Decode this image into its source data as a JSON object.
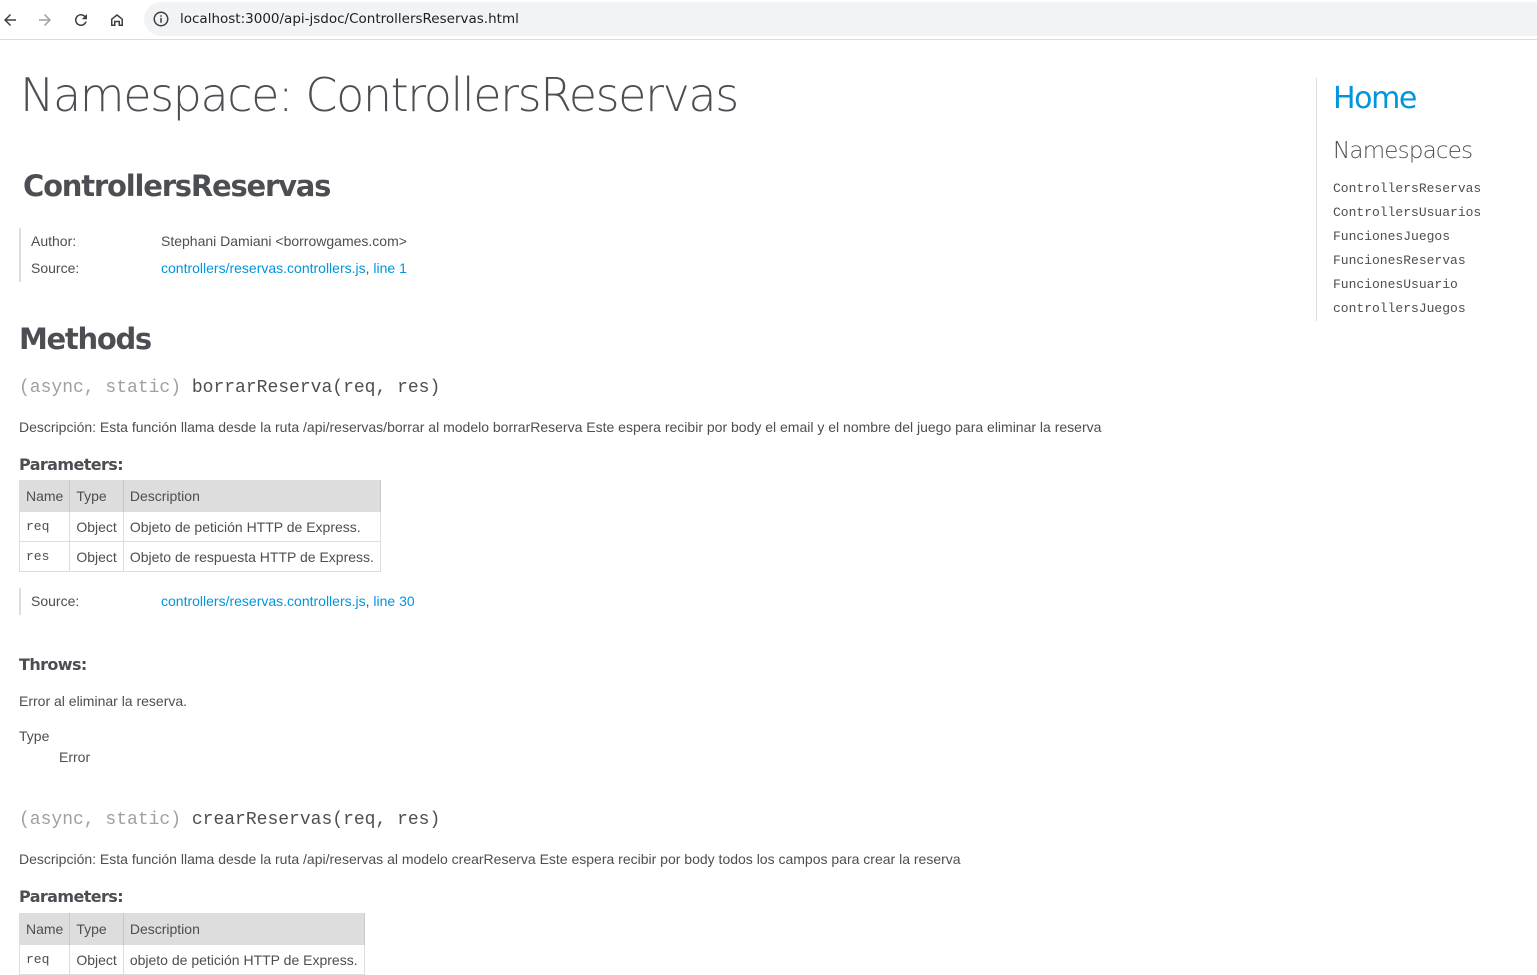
{
  "browser": {
    "url": "localhost:3000/api-jsdoc/ControllersReservas.html",
    "back_icon": "arrow-left-icon",
    "forward_icon": "arrow-right-icon",
    "reload_icon": "reload-icon",
    "home_icon": "home-icon",
    "site_info_icon": "info-circle-icon"
  },
  "page": {
    "title": "Namespace: ControllersReservas",
    "namespace_heading": "ControllersReservas",
    "details": {
      "author_label": "Author:",
      "author_value": "Stephani Damiani <borrowgames.com>",
      "source_label": "Source:",
      "source_file": "controllers/reservas.controllers.js",
      "source_line": "line 1"
    },
    "methods_heading": "Methods"
  },
  "methods": [
    {
      "attrs": "(async, static)",
      "signature": "borrarReserva(req, res)",
      "description": "Descripción: Esta función llama desde la ruta /api/reservas/borrar al modelo borrarReserva Este espera recibir por body el email y el nombre del juego para eliminar la reserva",
      "parameters_heading": "Parameters:",
      "table_headers": [
        "Name",
        "Type",
        "Description"
      ],
      "params": [
        {
          "name": "req",
          "type": "Object",
          "description": "Objeto de petición HTTP de Express."
        },
        {
          "name": "res",
          "type": "Object",
          "description": "Objeto de respuesta HTTP de Express."
        }
      ],
      "source_label": "Source:",
      "source_file": "controllers/reservas.controllers.js",
      "source_line": "line 30",
      "throws_heading": "Throws:",
      "throws_description": "Error al eliminar la reserva.",
      "type_label": "Type",
      "type_value": "Error"
    },
    {
      "attrs": "(async, static)",
      "signature": "crearReservas(req, res)",
      "description": "Descripción: Esta función llama desde la ruta /api/reservas al modelo crearReserva Este espera recibir por body todos los campos para crear la reserva",
      "parameters_heading": "Parameters:",
      "table_headers": [
        "Name",
        "Type",
        "Description"
      ],
      "params": [
        {
          "name": "req",
          "type": "Object",
          "description": "objeto de petición HTTP de Express."
        }
      ]
    }
  ],
  "sidebar": {
    "home": "Home",
    "namespaces_heading": "Namespaces",
    "items": [
      "ControllersReservas",
      "ControllersUsuarios",
      "FuncionesJuegos",
      "FuncionesReservas",
      "FuncionesUsuario",
      "controllersJuegos"
    ]
  },
  "colors": {
    "link": "#0095dd",
    "text": "#4d4e53",
    "table_header_bg": "#dddddd",
    "url_bar_bg": "#f1f3f4"
  }
}
